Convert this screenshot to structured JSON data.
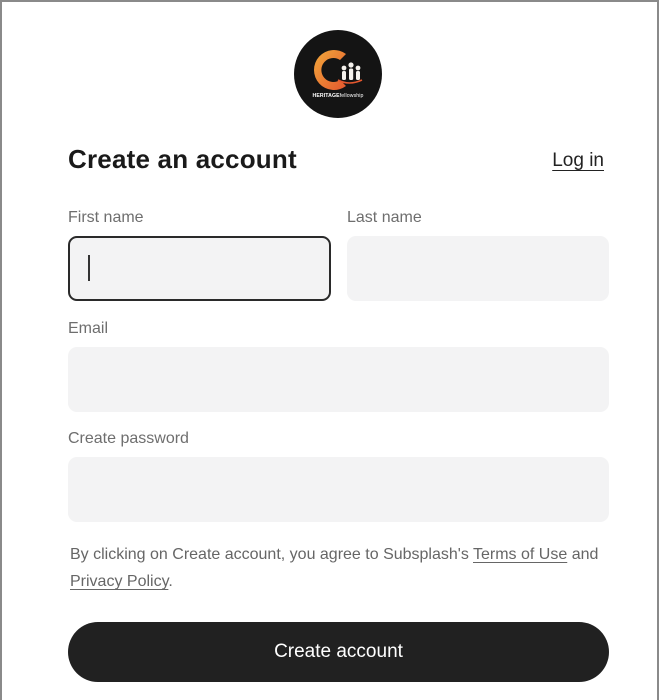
{
  "logo": {
    "text_bold": "HERITAGE",
    "text_light": "fellowship",
    "colors": {
      "background": "#141414",
      "flame": "#e4572e",
      "accent": "#f2a93b"
    }
  },
  "header": {
    "title": "Create an account",
    "login_label": "Log in"
  },
  "form": {
    "first_name": {
      "label": "First name",
      "value": "",
      "placeholder": ""
    },
    "last_name": {
      "label": "Last name",
      "value": "",
      "placeholder": ""
    },
    "email": {
      "label": "Email",
      "value": "",
      "placeholder": ""
    },
    "password": {
      "label": "Create password",
      "value": "",
      "placeholder": ""
    }
  },
  "terms": {
    "prefix": "By clicking on Create account, you agree to Subsplash's",
    "terms_link": "Terms of Use",
    "and": "and",
    "privacy_link": "Privacy Policy",
    "suffix": "."
  },
  "submit": {
    "label": "Create account"
  }
}
